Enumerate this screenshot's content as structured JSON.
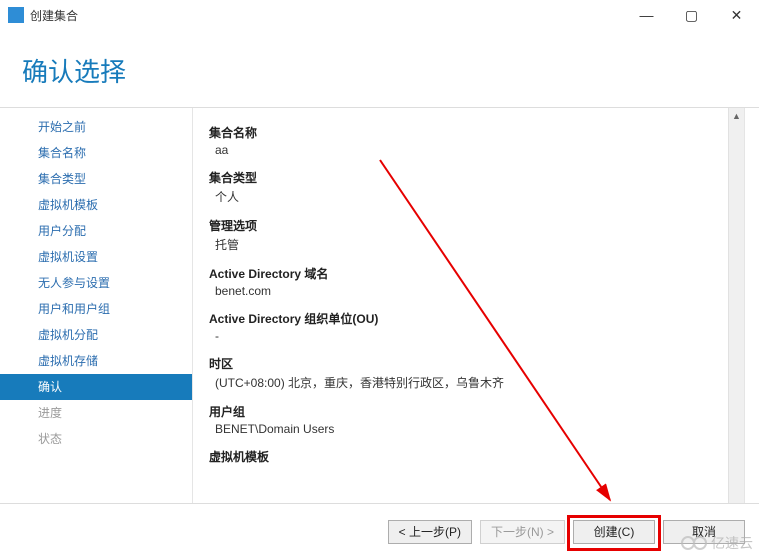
{
  "window": {
    "title": "创建集合",
    "min_icon": "—",
    "max_icon": "▢",
    "close_icon": "✕"
  },
  "heading": "确认选择",
  "nav": {
    "items": [
      {
        "label": "开始之前",
        "state": "link"
      },
      {
        "label": "集合名称",
        "state": "link"
      },
      {
        "label": "集合类型",
        "state": "link"
      },
      {
        "label": "虚拟机模板",
        "state": "link"
      },
      {
        "label": "用户分配",
        "state": "link"
      },
      {
        "label": "虚拟机设置",
        "state": "link"
      },
      {
        "label": "无人参与设置",
        "state": "link"
      },
      {
        "label": "用户和用户组",
        "state": "link"
      },
      {
        "label": "虚拟机分配",
        "state": "link"
      },
      {
        "label": "虚拟机存储",
        "state": "link"
      },
      {
        "label": "确认",
        "state": "selected"
      },
      {
        "label": "进度",
        "state": "disabled"
      },
      {
        "label": "状态",
        "state": "disabled"
      }
    ]
  },
  "summary": [
    {
      "label": "集合名称",
      "value": "aa"
    },
    {
      "label": "集合类型",
      "value": "个人"
    },
    {
      "label": "管理选项",
      "value": "托管"
    },
    {
      "label": "Active Directory 域名",
      "value": "benet.com"
    },
    {
      "label": "Active Directory 组织单位(OU)",
      "value": "-"
    },
    {
      "label": "时区",
      "value": "(UTC+08:00) 北京，重庆，香港特别行政区，乌鲁木齐"
    },
    {
      "label": "用户组",
      "value": "BENET\\Domain Users"
    },
    {
      "label": "虚拟机模板",
      "value": ""
    }
  ],
  "footer": {
    "prev": "< 上一步(P)",
    "next": "下一步(N) >",
    "create": "创建(C)",
    "cancel": "取消"
  },
  "watermark": "亿速云"
}
